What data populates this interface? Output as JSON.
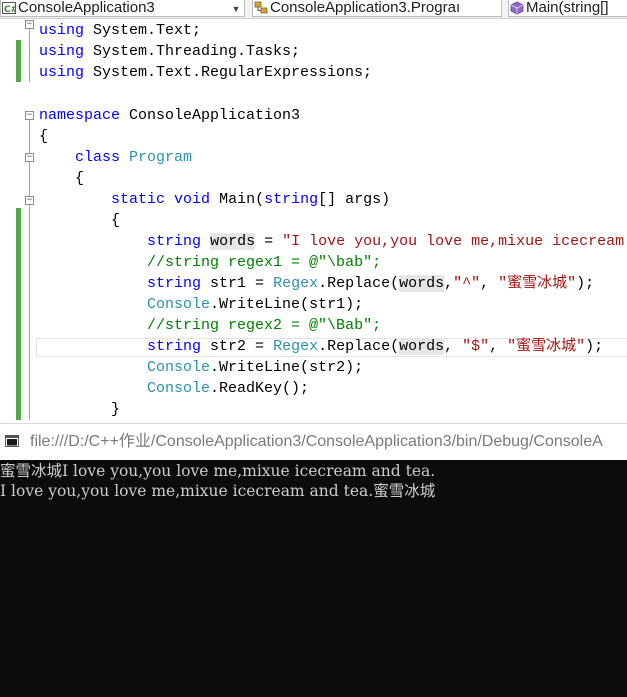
{
  "navbar": {
    "project_dropdown": {
      "icon": "csharp-project-icon",
      "label": "ConsoleApplication3"
    },
    "class_dropdown": {
      "icon": "class-icon",
      "label": "ConsoleApplication3.Prograı"
    },
    "member_dropdown": {
      "icon": "method-icon",
      "label": "Main(string[]"
    }
  },
  "code": {
    "line1": {
      "kw": "using",
      "rest": " System.Text;"
    },
    "line2": {
      "kw": "using",
      "rest": " System.Threading.Tasks;"
    },
    "line3": {
      "kw": "using",
      "rest": " System.Text.RegularExpressions;"
    },
    "line5": {
      "kw": "namespace",
      "rest": " ConsoleApplication3"
    },
    "line6": {
      "text": "{"
    },
    "line7": {
      "kw": "class",
      "type": "Program"
    },
    "line8": {
      "text": "{"
    },
    "line9": {
      "kw1": "static",
      "kw2": "void",
      "name": " Main(",
      "kw3": "string",
      "rest": "[] args)"
    },
    "line10": {
      "text": "{"
    },
    "line11": {
      "kw": "string",
      "var": "words",
      "op": " = ",
      "str": "\"I love you,you love me,mixue icecream"
    },
    "line12": {
      "comment": "//string regex1 = @\"\\bab\";"
    },
    "line13": {
      "kw": "string",
      "a": " str1 = ",
      "type": "Regex",
      "b": ".Replace(",
      "var": "words",
      "c": ",",
      "s1": "\"^\"",
      "d": ", ",
      "s2": "\"蜜雪冰城\"",
      "e": ");"
    },
    "line14": {
      "type": "Console",
      "rest": ".WriteLine(str1);"
    },
    "line15": {
      "comment": "//string regex2 = @\"\\Bab\";"
    },
    "line16": {
      "kw": "string",
      "a": " str2 = ",
      "type": "Regex",
      "b": ".Replace(",
      "var": "words",
      "c": ", ",
      "s1": "\"$\"",
      "d": ", ",
      "s2": "\"蜜雪冰城\"",
      "e": ");"
    },
    "line17": {
      "type": "Console",
      "rest": ".WriteLine(str2);"
    },
    "line18": {
      "type": "Console",
      "rest": ".ReadKey();"
    },
    "line19": {
      "text": "}"
    }
  },
  "console": {
    "icon": "console-window-icon",
    "title": "file:///D:/C++作业/ConsoleApplication3/ConsoleApplication3/bin/Debug/ConsoleA",
    "output": [
      "蜜雪冰城I love you,you love me,mixue icecream and tea.",
      "I love you,you love me,mixue icecream and tea.蜜雪冰城"
    ]
  },
  "colors": {
    "keyword": "#0000ff",
    "type": "#2b91af",
    "string": "#a31515",
    "comment": "#008000",
    "change_bar": "#57a64a",
    "console_bg": "#0c0c0c",
    "console_text": "#cccccc"
  }
}
